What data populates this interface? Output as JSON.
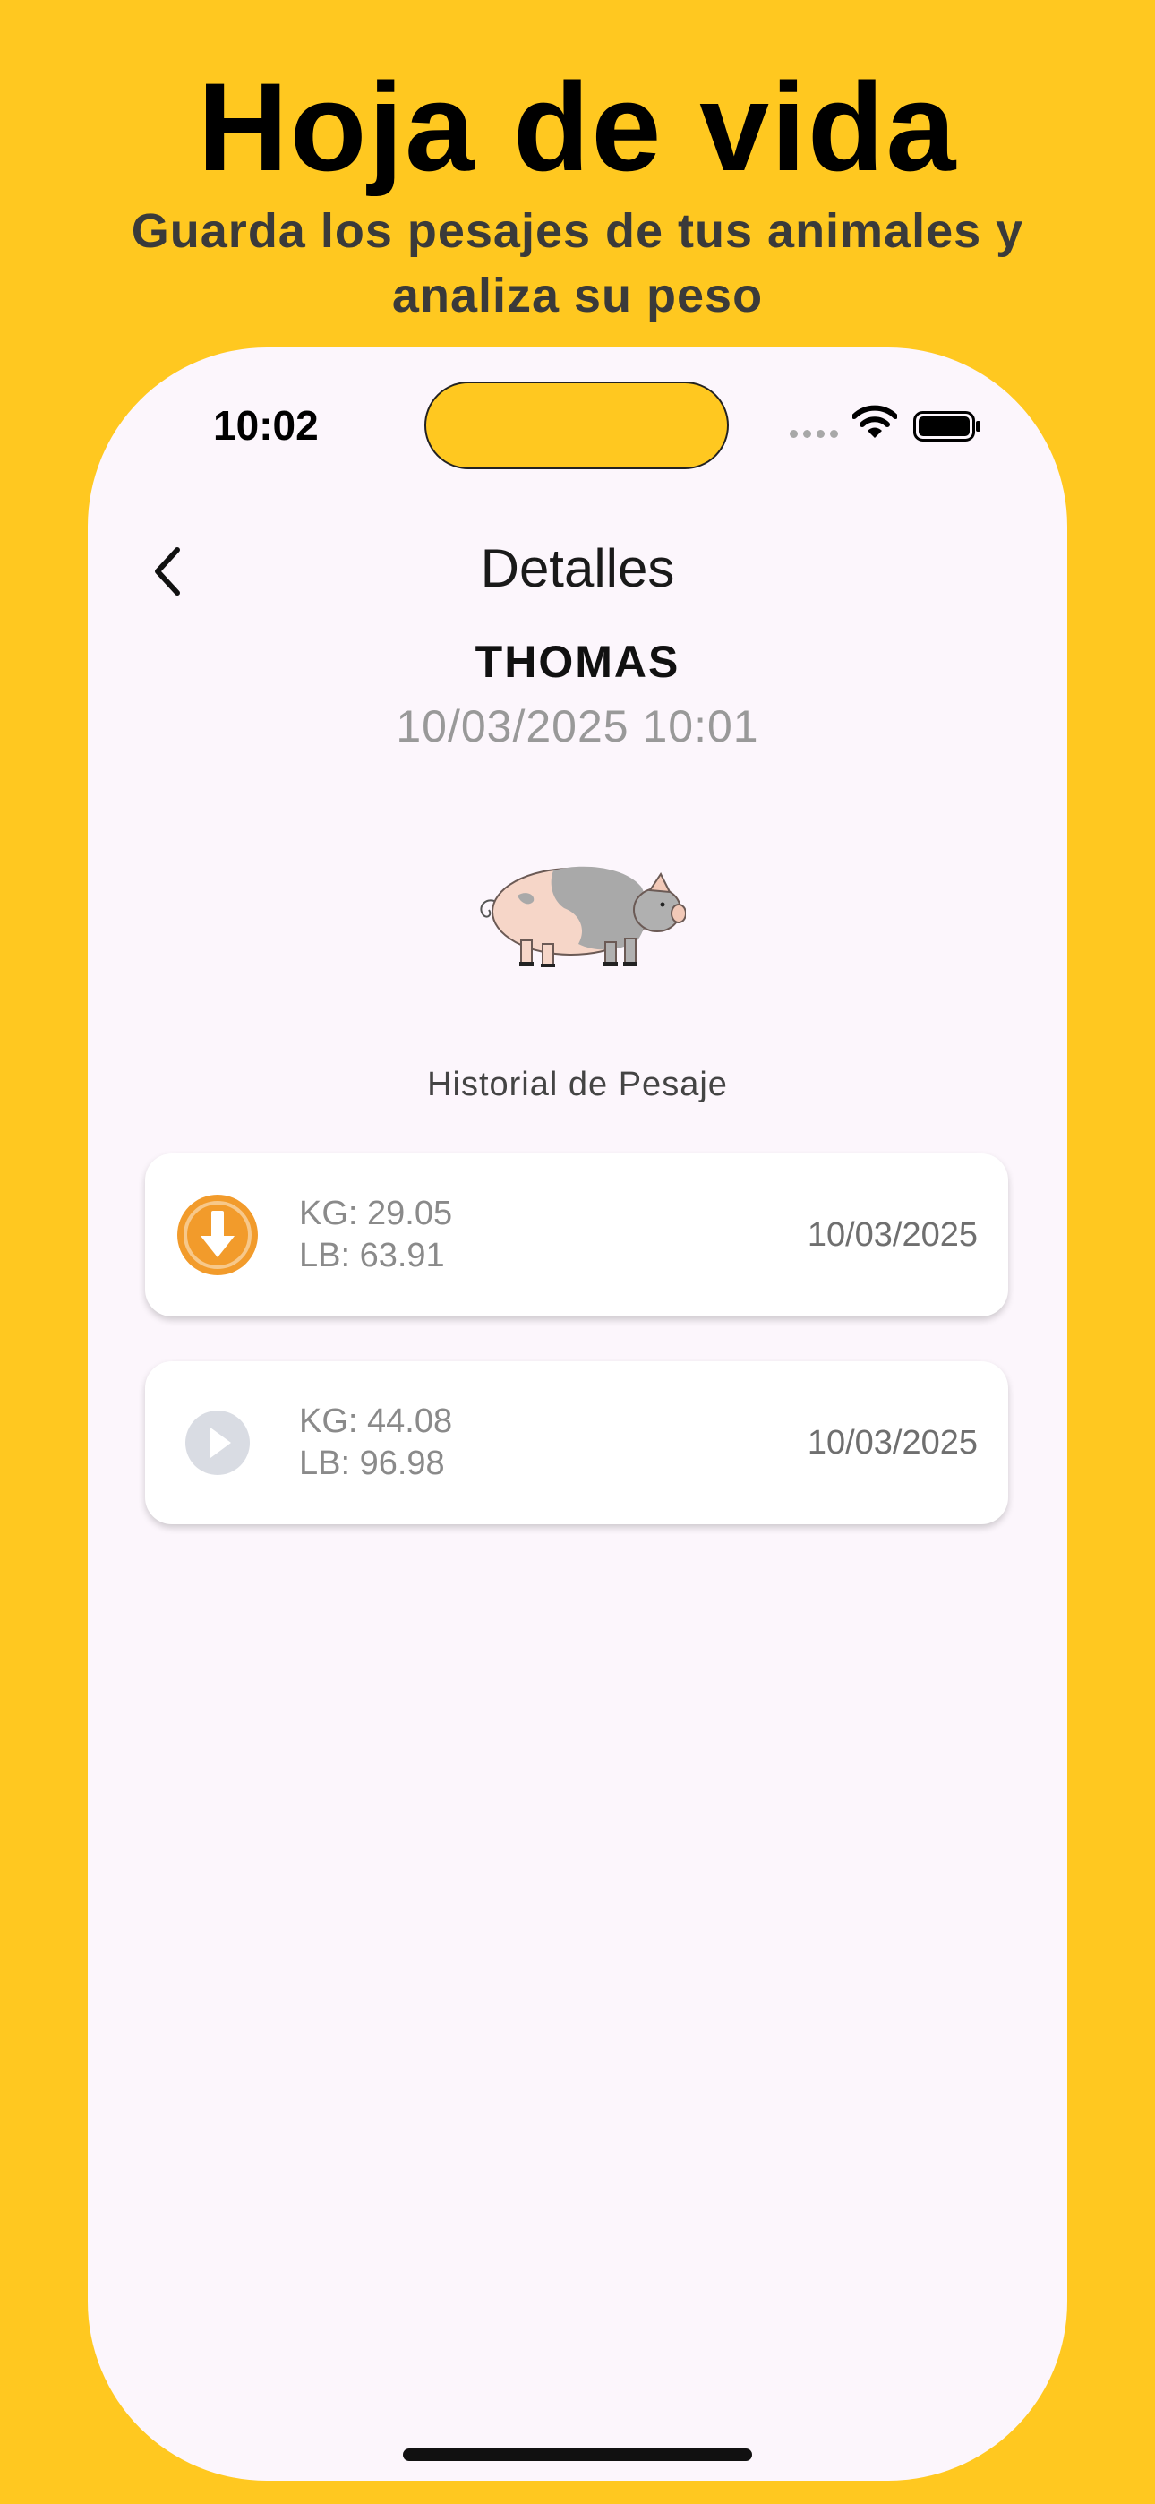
{
  "promo": {
    "title": "Hoja de vida",
    "subtitle": "Guarda los pesajes de tus animales y analiza su peso"
  },
  "status_bar": {
    "time": "10:02",
    "icons": [
      "cellular-signal-icon",
      "wifi-icon",
      "battery-icon"
    ]
  },
  "header": {
    "back_icon": "chevron-left-icon",
    "title": "Detalles"
  },
  "animal": {
    "name": "THOMAS",
    "datetime": "10/03/2025 10:01",
    "image": "pig-illustration"
  },
  "history": {
    "label": "Historial de Pesaje",
    "entries": [
      {
        "icon": "arrow-down-circle-icon",
        "icon_color": "#F29B2B",
        "kg": "KG: 29.05",
        "lb": "LB: 63.91",
        "date": "10/03/2025"
      },
      {
        "icon": "play-circle-icon",
        "icon_color": "#D9DCE3",
        "kg": "KG: 44.08",
        "lb": "LB: 96.98",
        "date": "10/03/2025"
      }
    ]
  },
  "colors": {
    "background": "#FFC820",
    "screen": "#FCF6FC",
    "weight_down": "#F29B2B",
    "weight_neutral": "#D9DCE3"
  }
}
